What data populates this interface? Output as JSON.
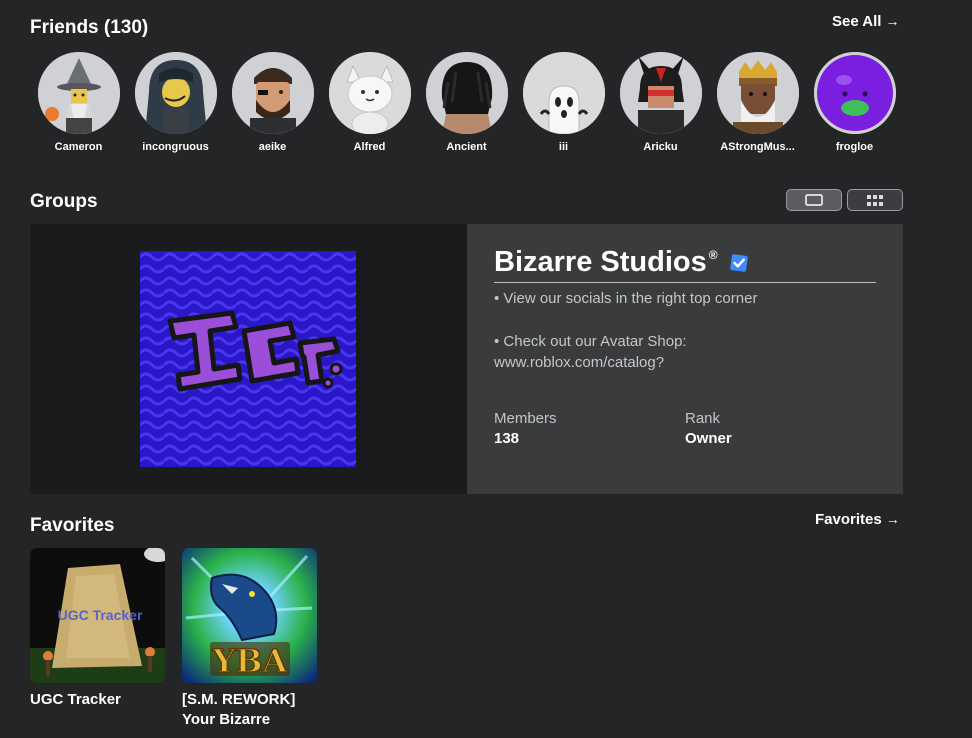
{
  "friends_section": {
    "title": "Friends (130)",
    "see_all": "See All",
    "arrow": "→",
    "friends": [
      {
        "name": "Cameron",
        "icon": "witch-hat-avatar"
      },
      {
        "name": "incongruous",
        "icon": "dark-hair-avatar"
      },
      {
        "name": "aeike",
        "icon": "bearded-avatar"
      },
      {
        "name": "Alfred",
        "icon": "white-cat-avatar"
      },
      {
        "name": "Ancient",
        "icon": "back-head-avatar"
      },
      {
        "name": "iii",
        "icon": "ghost-avatar"
      },
      {
        "name": "Aricku",
        "icon": "horned-avatar"
      },
      {
        "name": "AStrongMus...",
        "icon": "crowned-avatar"
      },
      {
        "name": "frogloe",
        "icon": "purple-blob-avatar"
      }
    ]
  },
  "groups_section": {
    "title": "Groups",
    "group": {
      "name": "Bizarre Studios",
      "registered_mark": "®",
      "emblem_text": "ゴゴゴ",
      "description_1": "• View our socials in the right top corner",
      "description_2": "• Check out our Avatar Shop:",
      "description_3": "www.roblox.com/catalog?",
      "members_label": "Members",
      "members_value": "138",
      "rank_label": "Rank",
      "rank_value": "Owner"
    }
  },
  "favorites_section": {
    "title": "Favorites",
    "link": "Favorites",
    "arrow": "→",
    "items": [
      {
        "name_line1": "UGC Tracker",
        "name_line2": "",
        "thumb_text": "UGC Tracker"
      },
      {
        "name_line1": "[S.M. REWORK]",
        "name_line2": "Your Bizarre",
        "thumb_text": "YBA"
      }
    ]
  },
  "colors": {
    "background": "#232527",
    "card_dark": "#191b1d",
    "card_light": "#393b3d",
    "verified_blue": "#3d8bff",
    "emblem_purple": "#8a3fd6"
  }
}
